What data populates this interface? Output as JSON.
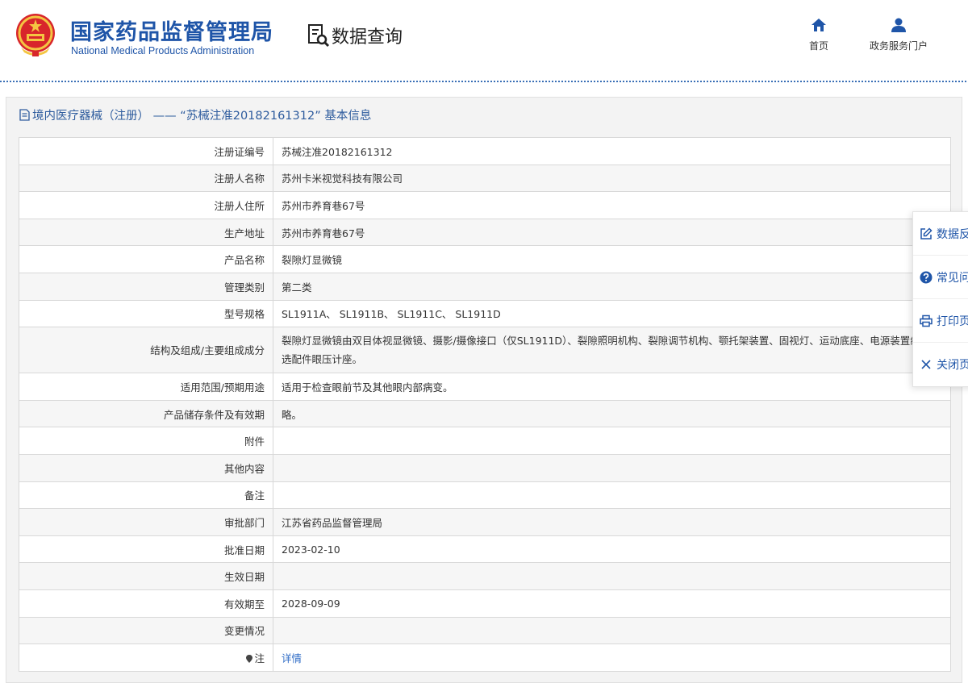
{
  "header": {
    "brand_cn": "国家药品监督管理局",
    "brand_en": "National Medical Products Administration",
    "section": "数据查询",
    "nav": [
      {
        "label": "首页",
        "icon": "home-icon"
      },
      {
        "label": "政务服务门户",
        "icon": "user-icon"
      }
    ]
  },
  "panel": {
    "title": "境内医疗器械（注册） —— “苏械注准20182161312” 基本信息"
  },
  "rows": [
    {
      "label": "注册证编号",
      "value": "苏械注准20182161312"
    },
    {
      "label": "注册人名称",
      "value": "苏州卡米视觉科技有限公司"
    },
    {
      "label": "注册人住所",
      "value": "苏州市养育巷67号"
    },
    {
      "label": "生产地址",
      "value": "苏州市养育巷67号"
    },
    {
      "label": "产品名称",
      "value": "裂隙灯显微镜"
    },
    {
      "label": "管理类别",
      "value": "第二类"
    },
    {
      "label": "型号规格",
      "value": "SL1911A、 SL1911B、 SL1911C、 SL1911D"
    },
    {
      "label": "结构及组成/主要组成成分",
      "value": "裂隙灯显微镜由双目体视显微镜、摄影/摄像接口（仅SL1911D）、裂隙照明机构、裂隙调节机构、颚托架装置、固视灯、运动底座、电源装置组成，选配件眼压计座。"
    },
    {
      "label": "适用范围/预期用途",
      "value": "适用于检查眼前节及其他眼内部病变。"
    },
    {
      "label": "产品储存条件及有效期",
      "value": "略。"
    },
    {
      "label": "附件",
      "value": ""
    },
    {
      "label": "其他内容",
      "value": ""
    },
    {
      "label": "备注",
      "value": ""
    },
    {
      "label": "审批部门",
      "value": "江苏省药品监督管理局"
    },
    {
      "label": "批准日期",
      "value": "2023-02-10"
    },
    {
      "label": "生效日期",
      "value": ""
    },
    {
      "label": "有效期至",
      "value": "2028-09-09"
    },
    {
      "label": "变更情况",
      "value": ""
    }
  ],
  "note_row": {
    "label": "注",
    "link": "详情"
  },
  "side_menu": [
    {
      "label": "数据反馈",
      "icon": "edit-icon"
    },
    {
      "label": "常见问题",
      "icon": "question-icon"
    },
    {
      "label": "打印页面",
      "icon": "print-icon"
    },
    {
      "label": "关闭页面",
      "icon": "close-icon"
    }
  ],
  "colors": {
    "brand": "#1f55a8",
    "link": "#2e6bc6",
    "panel_bg": "#f3f3f3"
  }
}
